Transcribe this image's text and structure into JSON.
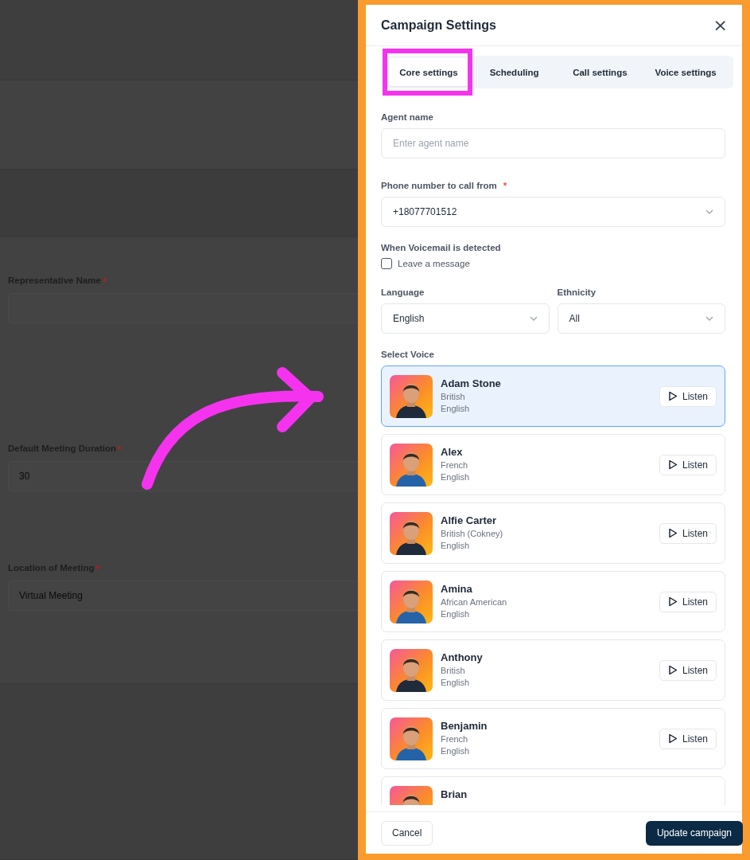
{
  "background_form": {
    "fields": [
      {
        "label": "Representative Name",
        "required_mark": "*"
      },
      {
        "label": "Default Meeting Duration",
        "required_mark": "*",
        "value": "30"
      },
      {
        "label": "Location of Meeting",
        "required_mark": "*",
        "value": "Virtual Meeting"
      }
    ]
  },
  "dialog": {
    "title": "Campaign Settings",
    "close": "×",
    "tabs": [
      {
        "label": "Core settings",
        "selected": true
      },
      {
        "label": "Scheduling",
        "selected": false
      },
      {
        "label": "Call settings",
        "selected": false
      },
      {
        "label": "Voice settings",
        "selected": false
      }
    ],
    "agent_name": {
      "label": "Agent name",
      "placeholder": "Enter agent name"
    },
    "phone": {
      "label": "Phone number to call from",
      "required_mark": "*",
      "value": "+18077701512"
    },
    "voicemail": {
      "label": "When Voicemail is detected",
      "option": "Leave a message",
      "checked": false
    },
    "language": {
      "label": "Language",
      "value": "English"
    },
    "ethnicity": {
      "label": "Ethnicity",
      "value": "All"
    },
    "voice_heading": "Select Voice",
    "voices": [
      {
        "name": "Adam Stone",
        "accent": "British",
        "language": "English",
        "listen": "Listen",
        "selected": true,
        "kind": "picture"
      },
      {
        "name": "Alex",
        "accent": "French",
        "language": "English",
        "listen": "Listen",
        "selected": false,
        "kind": "picture"
      },
      {
        "name": "Alfie Carter",
        "accent": "British (Cokney)",
        "language": "English",
        "listen": "Listen",
        "selected": false,
        "kind": "picture"
      },
      {
        "name": "Amina",
        "accent": "African American",
        "language": "English",
        "listen": "Listen",
        "selected": false,
        "kind": "picture"
      },
      {
        "name": "Anthony",
        "accent": "British",
        "language": "English",
        "listen": "Listen",
        "selected": false,
        "kind": "picture"
      },
      {
        "name": "Benjamin",
        "accent": "French",
        "language": "English",
        "listen": "Listen",
        "selected": false,
        "kind": "picture"
      },
      {
        "name": "Brian",
        "selected": false,
        "kind": "picture"
      }
    ],
    "footer": {
      "cancel": "Cancel",
      "submit": "Update campaign"
    }
  }
}
